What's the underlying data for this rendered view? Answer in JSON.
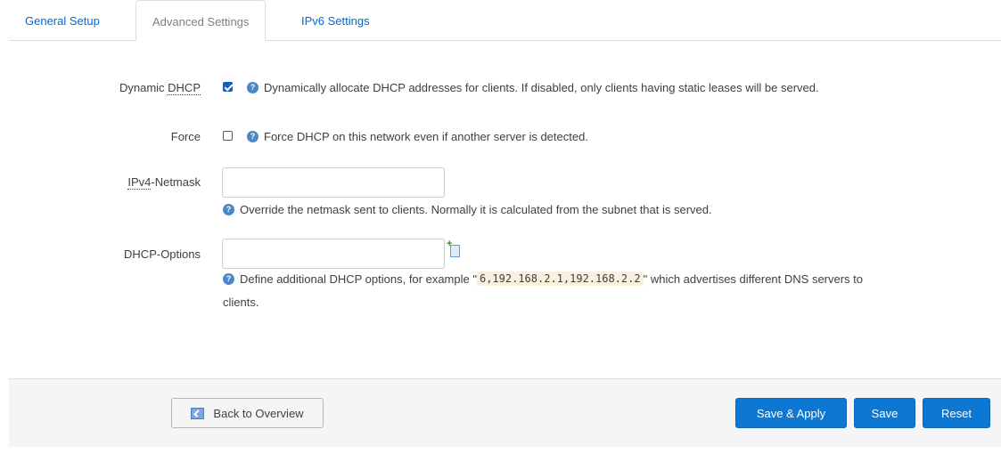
{
  "tabs": [
    {
      "label": "General Setup"
    },
    {
      "label": "Advanced Settings"
    },
    {
      "label": "IPv6 Settings"
    }
  ],
  "fields": {
    "dynamic_dhcp": {
      "label": "Dynamic DHCP",
      "checked": true,
      "help": "Dynamically allocate DHCP addresses for clients. If disabled, only clients having static leases will be served."
    },
    "force": {
      "label": "Force",
      "checked": false,
      "help": "Force DHCP on this network even if another server is detected."
    },
    "netmask": {
      "label_prefix": "IPv4",
      "label_suffix": "-Netmask",
      "value": "",
      "help": "Override the netmask sent to clients. Normally it is calculated from the subnet that is served."
    },
    "dhcp_options": {
      "label": "DHCP-Options",
      "value": "",
      "help_pre": "Define additional DHCP options, for example \"",
      "help_code": "6,192.168.2.1,192.168.2.2",
      "help_post": "\" which advertises different DNS servers to",
      "help_line2": "clients."
    }
  },
  "footer": {
    "back_label": "Back to Overview",
    "save_apply_label": "Save & Apply",
    "save_label": "Save",
    "reset_label": "Reset"
  },
  "colors": {
    "link": "#0069d6",
    "primary_button": "#0d78d4"
  }
}
